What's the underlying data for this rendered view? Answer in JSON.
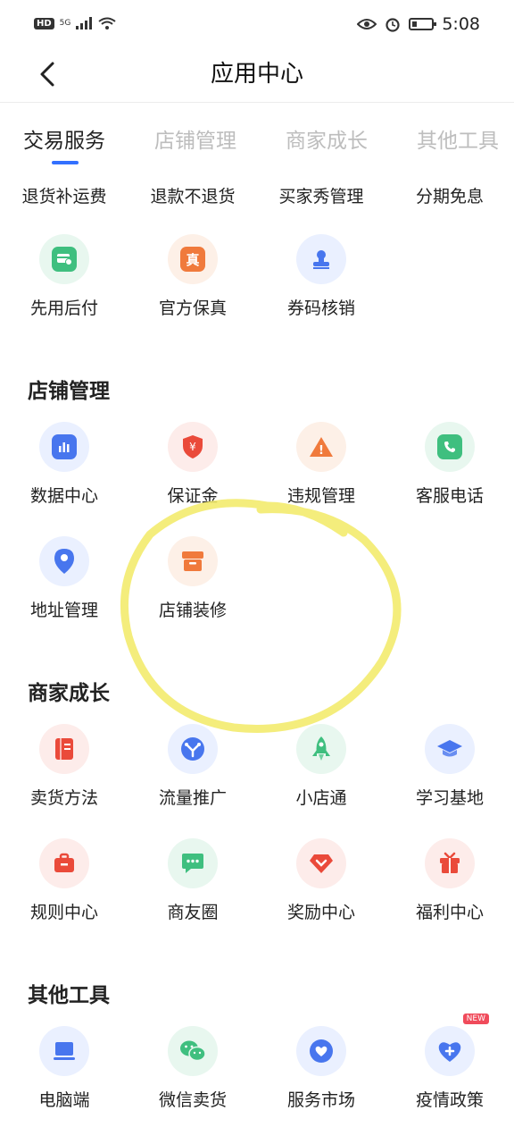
{
  "status_bar": {
    "network": "HD",
    "signal": "5G",
    "time": "5:08"
  },
  "nav": {
    "title": "应用中心"
  },
  "tabs": [
    {
      "label": "交易服务",
      "active": true
    },
    {
      "label": "店铺管理",
      "active": false
    },
    {
      "label": "商家成长",
      "active": false
    },
    {
      "label": "其他工具",
      "active": false
    }
  ],
  "sections": {
    "trade": {
      "items": [
        {
          "label": "退货补运费"
        },
        {
          "label": "退款不退货"
        },
        {
          "label": "买家秀管理"
        },
        {
          "label": "分期免息"
        },
        {
          "label": "先用后付",
          "icon": "card-clock-icon"
        },
        {
          "label": "官方保真",
          "icon": "genuine-icon",
          "glyph": "真"
        },
        {
          "label": "券码核销",
          "icon": "stamp-icon"
        }
      ]
    },
    "shop": {
      "title": "店铺管理",
      "items": [
        {
          "label": "数据中心",
          "icon": "bar-chart-icon"
        },
        {
          "label": "保证金",
          "icon": "shield-yen-icon",
          "glyph": "¥"
        },
        {
          "label": "违规管理",
          "icon": "warning-icon",
          "glyph": "!"
        },
        {
          "label": "客服电话",
          "icon": "phone-icon"
        },
        {
          "label": "地址管理",
          "icon": "location-pin-icon"
        },
        {
          "label": "店铺装修",
          "icon": "shop-box-icon"
        }
      ]
    },
    "growth": {
      "title": "商家成长",
      "items": [
        {
          "label": "卖货方法",
          "icon": "book-icon"
        },
        {
          "label": "流量推广",
          "icon": "traffic-icon"
        },
        {
          "label": "小店通",
          "icon": "rocket-icon"
        },
        {
          "label": "学习基地",
          "icon": "graduation-icon"
        },
        {
          "label": "规则中心",
          "icon": "briefcase-icon"
        },
        {
          "label": "商友圈",
          "icon": "chat-icon"
        },
        {
          "label": "奖励中心",
          "icon": "award-icon"
        },
        {
          "label": "福利中心",
          "icon": "gift-icon"
        }
      ]
    },
    "tools": {
      "title": "其他工具",
      "items": [
        {
          "label": "电脑端",
          "icon": "computer-icon"
        },
        {
          "label": "微信卖货",
          "icon": "wechat-icon"
        },
        {
          "label": "服务市场",
          "icon": "heart-icon"
        },
        {
          "label": "疫情政策",
          "icon": "heart-plus-icon",
          "badge": "NEW"
        }
      ]
    }
  },
  "colors": {
    "accent": "#3370ff",
    "annotation": "#f3ea6a"
  }
}
